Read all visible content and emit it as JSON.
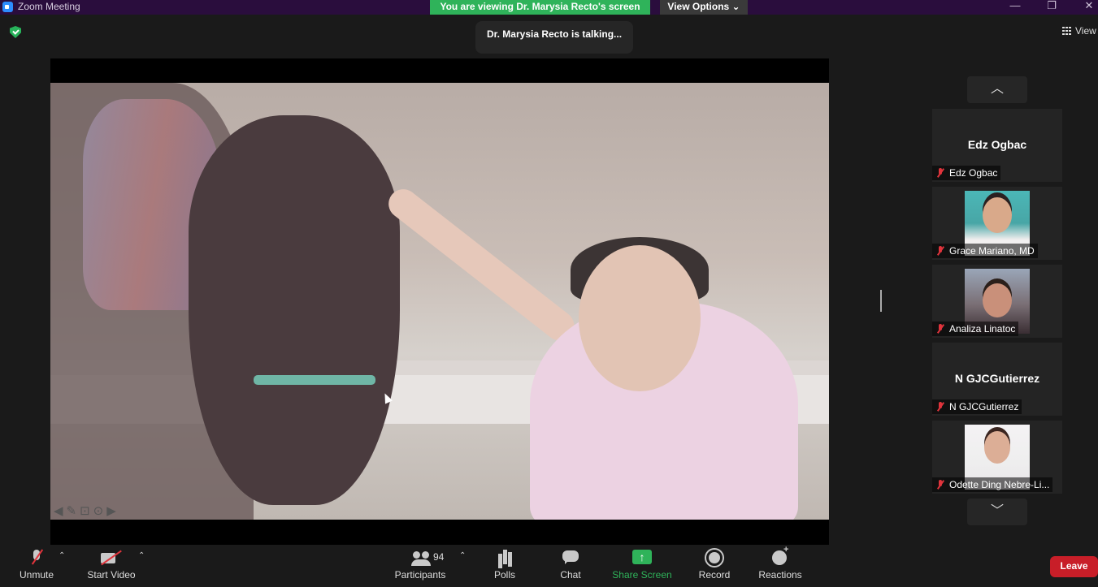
{
  "window": {
    "title": "Zoom Meeting",
    "minimize": "—",
    "restore": "❐",
    "close": "✕"
  },
  "banner": {
    "viewing": "You are viewing Dr. Marysia Recto's screen",
    "view_options": "View Options ⌄"
  },
  "talking_indicator": "Dr. Marysia Recto is talking...",
  "view_button": "View",
  "slide_controls": "◀✎⊡⊙▶",
  "gallery": {
    "nav_up": "︿",
    "nav_down": "﹀",
    "participants": [
      {
        "display_name": "Edz Ogbac",
        "label": "Edz Ogbac",
        "has_video": false,
        "muted": true
      },
      {
        "display_name": "",
        "label": "Grace Mariano, MD",
        "has_video": true,
        "muted": true
      },
      {
        "display_name": "",
        "label": "Analiza Linatoc",
        "has_video": true,
        "muted": true
      },
      {
        "display_name": "N GJCGutierrez",
        "label": "N GJCGutierrez",
        "has_video": false,
        "muted": true
      },
      {
        "display_name": "",
        "label": "Odette Ding Nebre-Li...",
        "has_video": true,
        "muted": true
      }
    ]
  },
  "toolbar": {
    "unmute": "Unmute",
    "start_video": "Start Video",
    "caret": "⌃",
    "participants": "Participants",
    "participant_count": "94",
    "polls": "Polls",
    "chat": "Chat",
    "share_screen": "Share Screen",
    "record": "Record",
    "reactions": "Reactions",
    "leave": "Leave"
  },
  "colors": {
    "titlebar": "#2a0d3d",
    "banner_green": "#2fb35a",
    "leave_red": "#c81e28",
    "muted_red": "#e0343c"
  }
}
